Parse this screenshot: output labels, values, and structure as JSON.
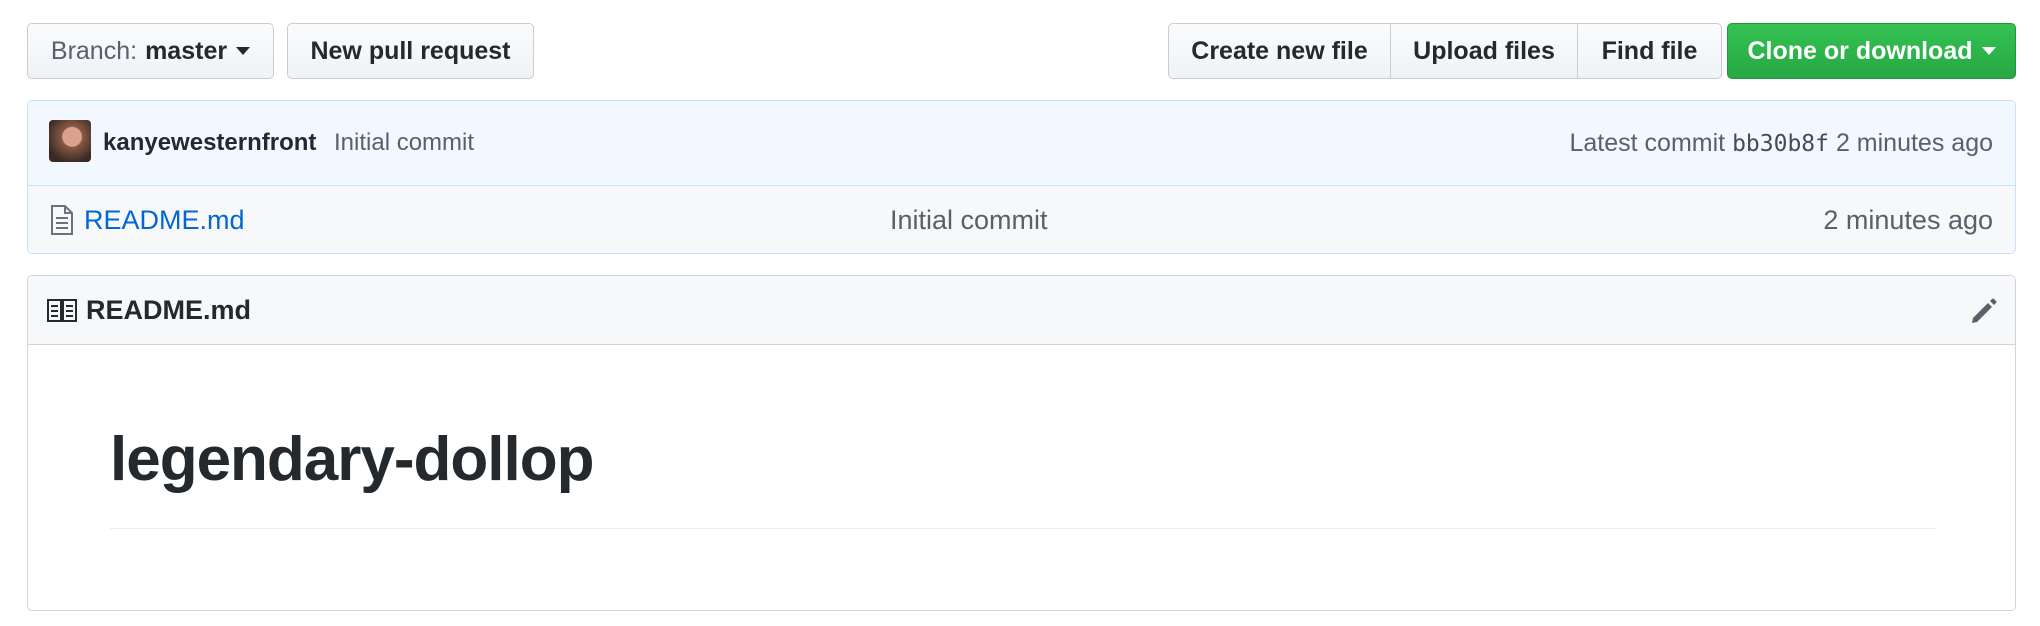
{
  "toolbar": {
    "branch_label": "Branch:",
    "branch_value": "master",
    "new_pr": "New pull request",
    "create_file": "Create new file",
    "upload_files": "Upload files",
    "find_file": "Find file",
    "clone": "Clone or download"
  },
  "commit": {
    "author": "kanyewesternfront",
    "message": "Initial commit",
    "latest_label": "Latest commit",
    "sha": "bb30b8f",
    "age": "2 minutes ago"
  },
  "files": [
    {
      "name": "README.md",
      "message": "Initial commit",
      "age": "2 minutes ago",
      "icon": "file-text-icon"
    }
  ],
  "readme": {
    "title": "README.md",
    "heading": "legendary-dollop"
  },
  "colors": {
    "green": "#28a745",
    "link": "#0366d6",
    "commit_bg": "#f1f8ff"
  }
}
